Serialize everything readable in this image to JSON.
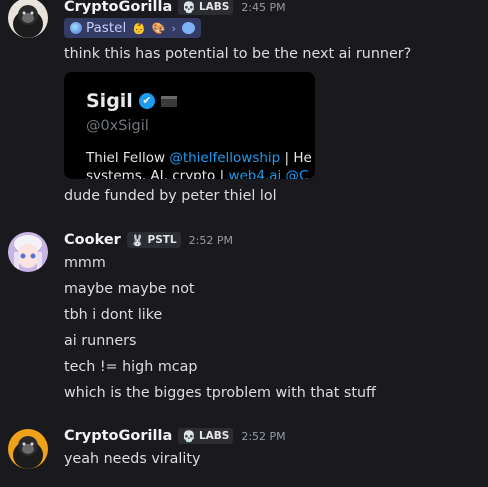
{
  "messages": [
    {
      "username": "CryptoGorilla",
      "tag_emoji": "💀",
      "tag_label": "LABS",
      "time": "2:45 PM",
      "role": {
        "label": "Pastel",
        "emoji1": "👶",
        "emoji2": "🎨",
        "chevron": "›"
      },
      "lines": [
        "think this has potential to be the next ai runner?",
        "dude funded by peter thiel lol"
      ],
      "embed": {
        "name": "Sigil",
        "verified_glyph": "✔",
        "handle": "@0xSigil",
        "bio_prefix": "Thiel Fellow ",
        "bio_link": "@thielfellowship",
        "bio_suffix": " | He",
        "bio2_prefix": "systems. AI, crypto | ",
        "bio2_link": "web4.ai @C"
      }
    },
    {
      "username": "Cooker",
      "tag_emoji": "🐰",
      "tag_label": "PSTL",
      "time": "2:52 PM",
      "lines": [
        "mmm",
        "maybe maybe not",
        "tbh i dont like",
        "ai runners",
        "tech != high mcap",
        "which is the bigges tproblem with that stuff"
      ]
    },
    {
      "username": "CryptoGorilla",
      "tag_emoji": "💀",
      "tag_label": "LABS",
      "time": "2:52 PM",
      "lines": [
        "yeah needs virality"
      ]
    }
  ]
}
